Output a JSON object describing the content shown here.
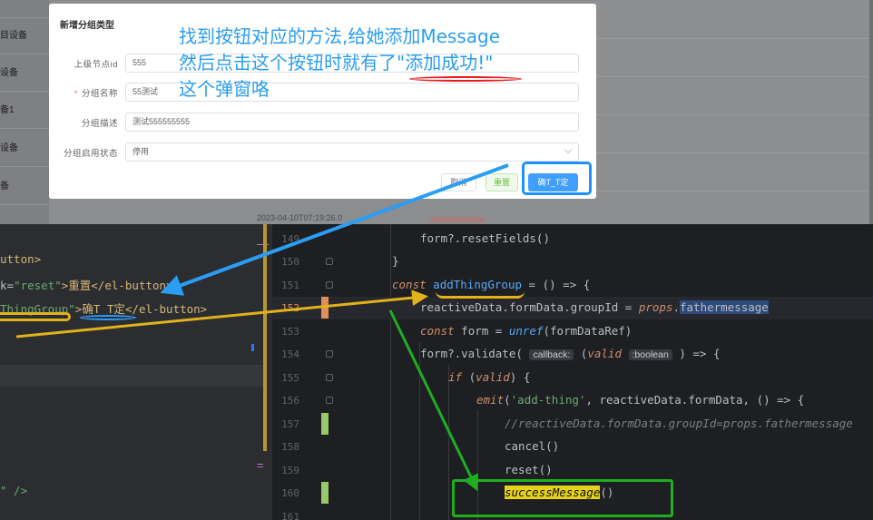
{
  "app": {
    "sidebar_items": [
      "",
      "目设备",
      "设备",
      "备1",
      "设备",
      "备"
    ],
    "date_text": "2023-04-10T07:19:26.0"
  },
  "dialog": {
    "title": "新增分组类型",
    "fields": [
      {
        "label": "上级节点id",
        "value": "555",
        "required": false
      },
      {
        "label": "分组名称",
        "value": "55测试",
        "required": true
      },
      {
        "label": "分组描述",
        "value": "测试555555555",
        "required": false
      },
      {
        "label": "分组启用状态",
        "value": "停用",
        "required": false,
        "type": "select"
      }
    ],
    "buttons": {
      "cancel": "取消",
      "reset": "重置",
      "confirm": "确T_T定"
    }
  },
  "annotation": {
    "lines": [
      "找到按钮对应的方法,给她添加Message",
      "然后点击这个按钮时就有了\"添加成功!\"",
      "这个弹窗咯"
    ]
  },
  "left_code": [
    {
      "parts": [
        "utton>"
      ]
    },
    {
      "parts": [
        "k=",
        "\"reset\"",
        ">重置</el-button>"
      ]
    },
    {
      "parts": [
        "ThingGroup\"",
        ">确T_T定</el-button>"
      ]
    },
    {
      "parts": [
        "\" />"
      ]
    }
  ],
  "right_code": {
    "lines": [
      {
        "num": "149",
        "text": "form?.resetFields()"
      },
      {
        "num": "150",
        "text": "}"
      },
      {
        "num": "151",
        "text": "const addThingGroup = () => {"
      },
      {
        "num": "152",
        "text": "reactiveData.formData.groupId = props.fathermessage"
      },
      {
        "num": "153",
        "text": "const form = unref(formDataRef)"
      },
      {
        "num": "154",
        "text": "form?.validate( callback: (valid :boolean ) => {"
      },
      {
        "num": "155",
        "text": "if (valid) {"
      },
      {
        "num": "156",
        "text": "emit('add-thing', reactiveData.formData, () => {"
      },
      {
        "num": "157",
        "text": "//reactiveData.formData.groupId=props.fathermessage"
      },
      {
        "num": "158",
        "text": "cancel()"
      },
      {
        "num": "159",
        "text": "reset()"
      },
      {
        "num": "160",
        "text": "successMessage()"
      },
      {
        "num": "161",
        "text": ""
      }
    ],
    "hint_callback": "callback:",
    "hint_boolean": ":boolean"
  },
  "colors": {
    "annotation": "#2a9df4",
    "confirm_button": "#409eff",
    "green_box": "#1fae21",
    "yellow_arrow": "#e2b21c",
    "blue_arrow": "#2a9df4",
    "red_underline": "#e31b1b",
    "highlight_yellow": "#e5d21a"
  }
}
